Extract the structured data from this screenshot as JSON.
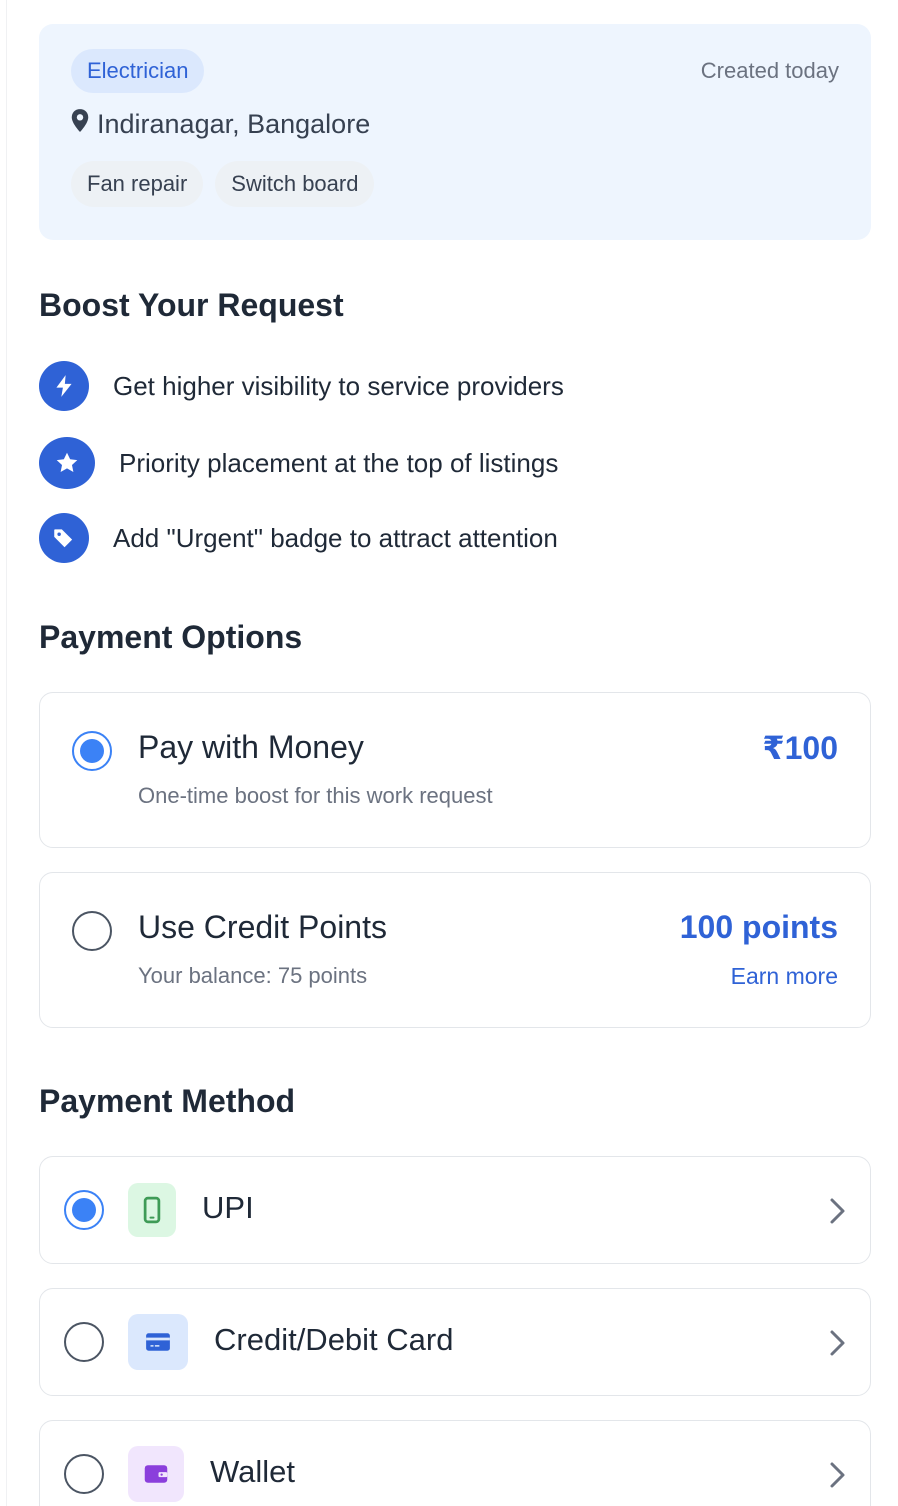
{
  "request": {
    "category": "Electrician",
    "created": "Created today",
    "location": "Indiranagar, Bangalore",
    "tags": [
      "Fan repair",
      "Switch board"
    ]
  },
  "boost": {
    "title": "Boost Your Request",
    "benefits": [
      {
        "icon": "lightning-icon",
        "text": "Get higher visibility to service providers"
      },
      {
        "icon": "star-icon",
        "text": "Priority placement at the top of listings"
      },
      {
        "icon": "tag-icon",
        "text": "Add \"Urgent\" badge to attract attention"
      }
    ]
  },
  "payment_options": {
    "title": "Payment Options",
    "money": {
      "label": "Pay with Money",
      "sublabel": "One-time boost for this work request",
      "price": "₹100",
      "selected": true
    },
    "credits": {
      "label": "Use Credit Points",
      "sublabel": "Your balance: 75 points",
      "price": "100 points",
      "link": "Earn more",
      "selected": false
    }
  },
  "payment_method": {
    "title": "Payment Method",
    "methods": [
      {
        "label": "UPI",
        "icon": "phone-icon",
        "selected": true
      },
      {
        "label": "Credit/Debit Card",
        "icon": "card-icon",
        "selected": false
      },
      {
        "label": "Wallet",
        "icon": "wallet-icon",
        "selected": false
      }
    ]
  },
  "colors": {
    "accent": "#2f62d6",
    "radio_selected": "#3b82f6",
    "card_bg": "#eef5fe",
    "upi_icon_bg": "#dcf7e3",
    "card_icon_bg": "#dbe8fd",
    "wallet_icon_bg": "#f1e6fd"
  }
}
